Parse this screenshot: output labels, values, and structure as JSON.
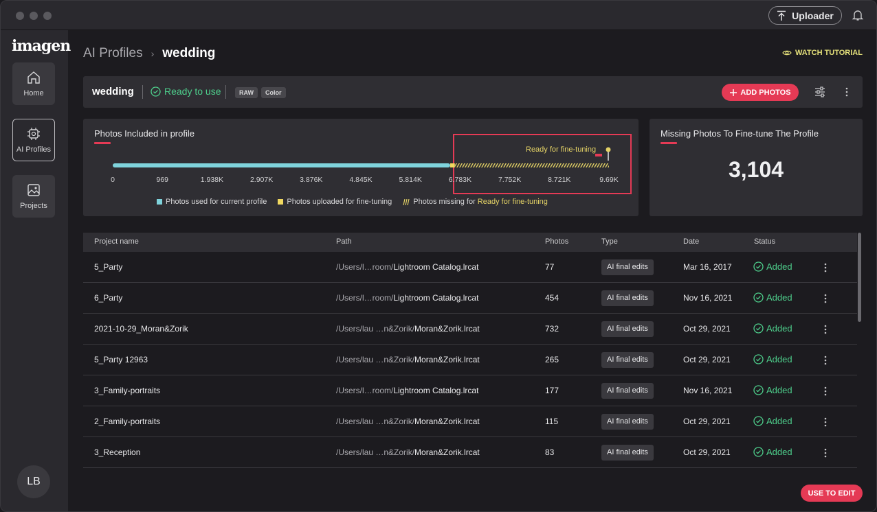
{
  "titlebar": {
    "uploader_label": "Uploader"
  },
  "sidebar": {
    "logo": "imagen",
    "items": [
      {
        "label": "Home",
        "icon": "home-icon"
      },
      {
        "label": "AI Profiles",
        "icon": "chip-icon",
        "active": true
      },
      {
        "label": "Projects",
        "icon": "image-icon"
      }
    ],
    "avatar_initials": "LB"
  },
  "breadcrumb": {
    "root": "AI Profiles",
    "current": "wedding"
  },
  "watch_tutorial": "WATCH TUTORIAL",
  "profile": {
    "name": "wedding",
    "status": "Ready to use",
    "tags": [
      "RAW",
      "Color"
    ],
    "add_photos": "ADD PHOTOS"
  },
  "photos_card": {
    "title": "Photos Included in profile",
    "marker_label": "Ready for fine-tuning",
    "legend": {
      "used": "Photos used for current profile",
      "uploaded": "Photos uploaded for fine-tuning",
      "missing_prefix": "Photos missing for ",
      "missing_highlight": "Ready for fine-tuning"
    }
  },
  "chart_data": {
    "type": "bar",
    "orientation": "horizontal-progress",
    "tick_labels": [
      "0",
      "969",
      "1.938K",
      "2.907K",
      "3.876K",
      "4.845K",
      "5.814K",
      "6.783K",
      "7.752K",
      "8.721K",
      "9.69K"
    ],
    "xlim": [
      0,
      9690
    ],
    "segments": [
      {
        "name": "Photos used for current profile",
        "start": 0,
        "end": 6590,
        "color": "#7fd3dc"
      },
      {
        "name": "Photos uploaded for fine-tuning",
        "start": 6590,
        "end": 6680,
        "color": "#f0d860"
      },
      {
        "name": "Photos missing for Ready for fine-tuning",
        "start": 6680,
        "end": 9690,
        "color": "#e4d266",
        "pattern": "hatched"
      }
    ],
    "marker": {
      "label": "Ready for fine-tuning",
      "value": 9690
    }
  },
  "missing_card": {
    "title": "Missing Photos To Fine-tune The Profile",
    "value": "3,104"
  },
  "table": {
    "headers": [
      "Project name",
      "Path",
      "Photos",
      "Type",
      "Date",
      "Status"
    ],
    "rows": [
      {
        "name": "5_Party",
        "path_dim": "/Users/l…room/",
        "path_file": "Lightroom Catalog.lrcat",
        "photos": "77",
        "type": "AI final edits",
        "date": "Mar 16, 2017",
        "status": "Added"
      },
      {
        "name": "6_Party",
        "path_dim": "/Users/l…room/",
        "path_file": "Lightroom Catalog.lrcat",
        "photos": "454",
        "type": "AI final edits",
        "date": "Nov 16, 2021",
        "status": "Added"
      },
      {
        "name": "2021-10-29_Moran&Zorik",
        "path_dim": "/Users/lau   …n&Zorik/",
        "path_file": "Moran&Zorik.lrcat",
        "photos": "732",
        "type": "AI final edits",
        "date": "Oct 29, 2021",
        "status": "Added"
      },
      {
        "name": "5_Party 12963",
        "path_dim": "/Users/lau   …n&Zorik/",
        "path_file": "Moran&Zorik.lrcat",
        "photos": "265",
        "type": "AI final edits",
        "date": "Oct 29, 2021",
        "status": "Added"
      },
      {
        "name": "3_Family-portraits",
        "path_dim": "/Users/l…room/",
        "path_file": "Lightroom Catalog.lrcat",
        "photos": "177",
        "type": "AI final edits",
        "date": "Nov 16, 2021",
        "status": "Added"
      },
      {
        "name": "2_Family-portraits",
        "path_dim": "/Users/lau   …n&Zorik/",
        "path_file": "Moran&Zorik.lrcat",
        "photos": "115",
        "type": "AI final edits",
        "date": "Oct 29, 2021",
        "status": "Added"
      },
      {
        "name": "3_Reception",
        "path_dim": "/Users/lau   …n&Zorik/",
        "path_file": "Moran&Zorik.lrcat",
        "photos": "83",
        "type": "AI final edits",
        "date": "Oct 29, 2021",
        "status": "Added"
      }
    ]
  },
  "use_to_edit": "USE TO EDIT",
  "colors": {
    "accent": "#e53a55",
    "success": "#4ecf8c",
    "highlight": "#e4d266",
    "used_bar": "#7fd3dc"
  }
}
